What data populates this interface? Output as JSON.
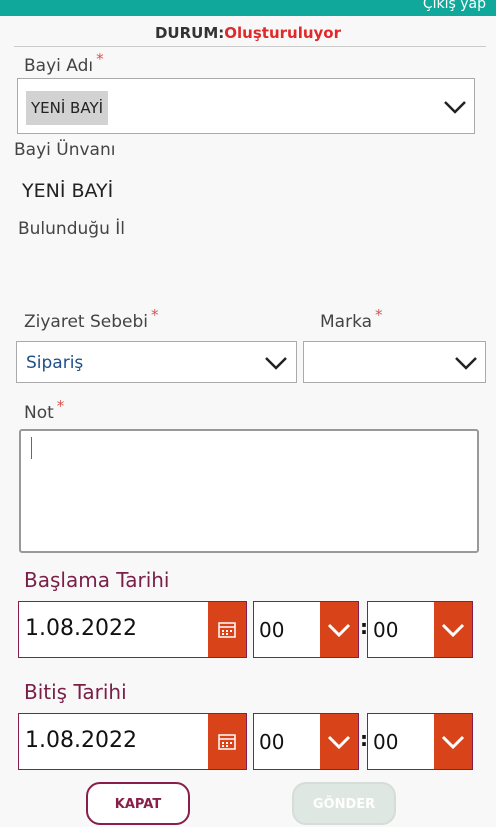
{
  "header": {
    "logout_label": "Çıkış yap"
  },
  "status": {
    "label": "DURUM:",
    "value": "Oluşturuluyor"
  },
  "form": {
    "dealer_name": {
      "label": "Bayi Adı",
      "required": "*",
      "value": "YENİ BAYİ"
    },
    "dealer_title": {
      "label": "Bayi Ünvanı",
      "value": "YENİ BAYİ"
    },
    "province": {
      "label": "Bulunduğu İl"
    },
    "visit_reason": {
      "label": "Ziyaret Sebebi",
      "required": "*",
      "value": "Sipariş"
    },
    "brand": {
      "label": "Marka",
      "required": "*",
      "value": ""
    },
    "note": {
      "label": "Not",
      "required": "*",
      "value": ""
    }
  },
  "start": {
    "label": "Başlama Tarihi",
    "date": "1.08.2022",
    "hour": "00",
    "minute": "00",
    "separator": ":"
  },
  "end": {
    "label": "Bitiş Tarihi",
    "date": "1.08.2022",
    "hour": "00",
    "minute": "00",
    "separator": ":"
  },
  "buttons": {
    "close_label": "KAPAT",
    "send_label": "GÖNDER"
  },
  "colors": {
    "accent": "#10a89a",
    "status_value": "#e0292b",
    "date_label": "#7a2048",
    "date_border": "#8a1e4a",
    "dropdown_button": "#d9431a"
  }
}
